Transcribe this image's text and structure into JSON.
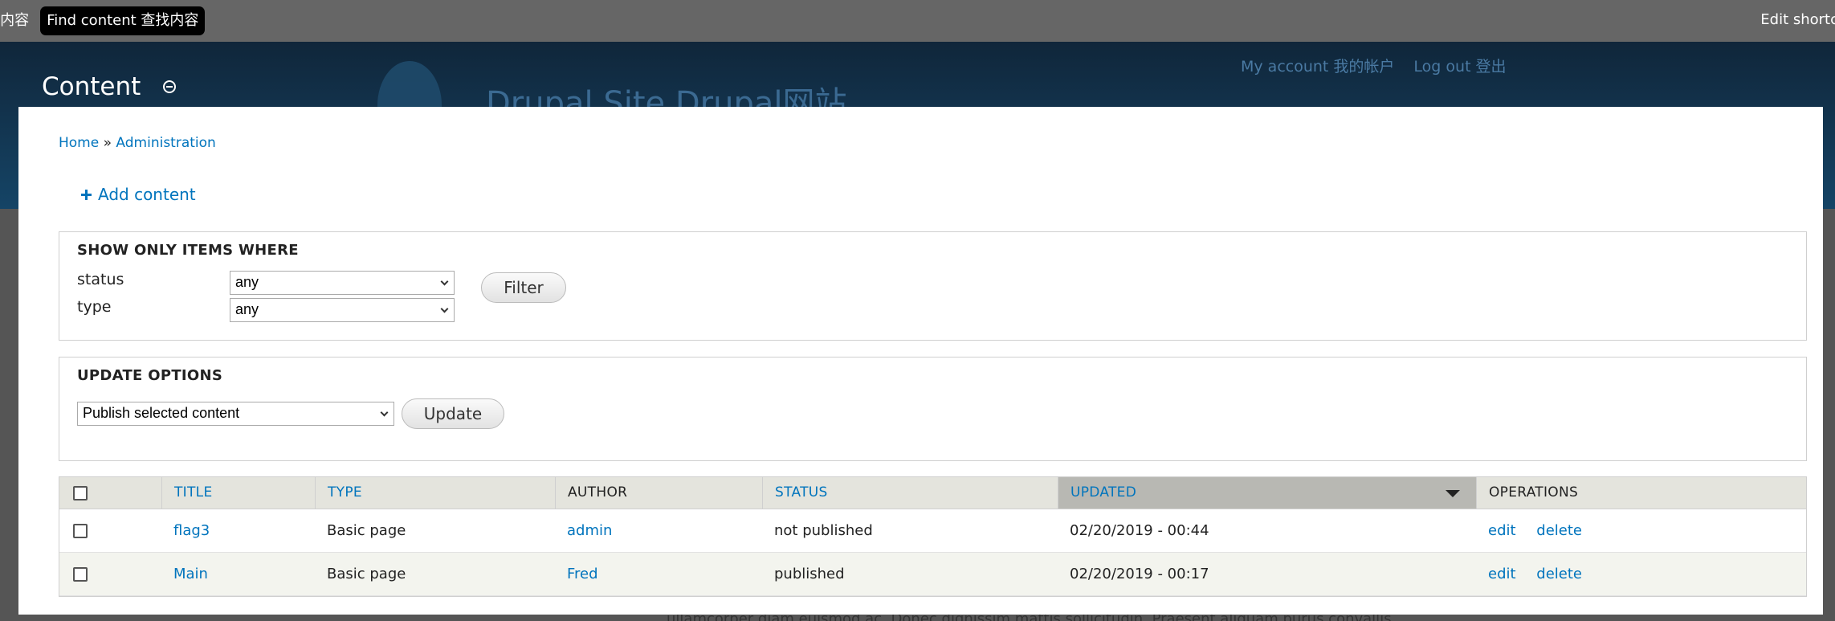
{
  "toolbar": {
    "add_content": "nt 添加内容",
    "find_content": "Find content 查找内容",
    "edit_shortcuts": "Edit shortc"
  },
  "header": {
    "site_name": "Drupal Site Drupal网站",
    "my_account": "My account 我的帐户",
    "log_out": "Log out 登出",
    "overlay_title": "Content"
  },
  "breadcrumb": {
    "home": "Home",
    "separator": "»",
    "administration": "Administration"
  },
  "actions": {
    "add_content": "Add content"
  },
  "filter": {
    "legend": "SHOW ONLY ITEMS WHERE",
    "status_label": "status",
    "status_value": "any",
    "type_label": "type",
    "type_value": "any",
    "button": "Filter"
  },
  "update": {
    "legend": "UPDATE OPTIONS",
    "operation_value": "Publish selected content",
    "button": "Update"
  },
  "table": {
    "headers": {
      "title": "TITLE",
      "type": "TYPE",
      "author": "AUTHOR",
      "status": "STATUS",
      "updated": "UPDATED",
      "operations": "OPERATIONS"
    },
    "rows": [
      {
        "title": "flag3",
        "type": "Basic page",
        "author": "admin",
        "status": "not published",
        "updated": "02/20/2019 - 00:44",
        "edit": "edit",
        "delete": "delete"
      },
      {
        "title": "Main",
        "type": "Basic page",
        "author": "Fred",
        "status": "published",
        "updated": "02/20/2019 - 00:17",
        "edit": "edit",
        "delete": "delete"
      }
    ]
  },
  "background_text": "ullamcorper diam euismod ac. Donec dignissim mattis sollicitudin. Praesent aliquam purus convallis",
  "colors": {
    "link": "#0074bd",
    "toolbar": "#666666",
    "header_dark": "#10263a",
    "table_header": "#e4e4dd",
    "sorted_header": "#b8b8b3"
  }
}
